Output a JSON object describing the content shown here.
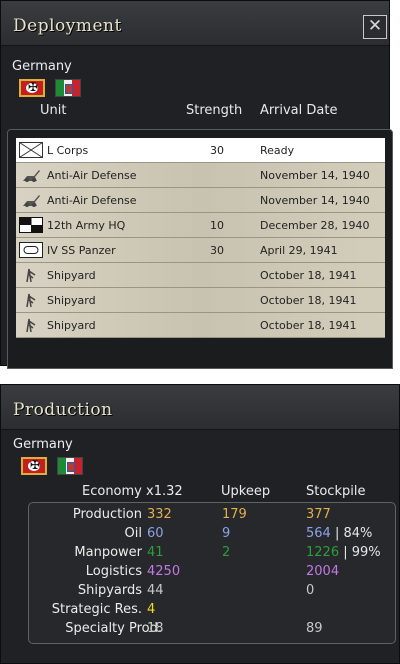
{
  "deployment": {
    "title": "Deployment",
    "close_glyph": "✕",
    "nation": "Germany",
    "columns": {
      "unit": "Unit",
      "strength": "Strength",
      "arrival": "Arrival Date"
    },
    "units": [
      {
        "icon": "infantry-corps-icon",
        "name": "L Corps",
        "strength": "30",
        "arrival": "Ready",
        "selected": true
      },
      {
        "icon": "anti-air-icon",
        "name": "Anti-Air Defense",
        "strength": "",
        "arrival": "November 14, 1940"
      },
      {
        "icon": "anti-air-icon",
        "name": "Anti-Air Defense",
        "strength": "",
        "arrival": "November 14, 1940"
      },
      {
        "icon": "hq-icon",
        "name": "12th Army HQ",
        "strength": "10",
        "arrival": "December 28, 1940"
      },
      {
        "icon": "armor-icon",
        "name": "IV SS Panzer",
        "strength": "30",
        "arrival": "April 29, 1941"
      },
      {
        "icon": "shipyard-icon",
        "name": "Shipyard",
        "strength": "",
        "arrival": "October 18, 1941"
      },
      {
        "icon": "shipyard-icon",
        "name": "Shipyard",
        "strength": "",
        "arrival": "October 18, 1941"
      },
      {
        "icon": "shipyard-icon",
        "name": "Shipyard",
        "strength": "",
        "arrival": "October 18, 1941"
      }
    ]
  },
  "production": {
    "title": "Production",
    "nation": "Germany",
    "columns": {
      "economy": "Economy x1.32",
      "upkeep": "Upkeep",
      "stockpile": "Stockpile"
    },
    "rows": {
      "production": {
        "label": "Production",
        "value": "332",
        "upkeep": "179",
        "stockpile": "377"
      },
      "oil": {
        "label": "Oil",
        "value": "60",
        "upkeep": "9",
        "stockpile": "564",
        "stockpile_pct": "84%"
      },
      "manpower": {
        "label": "Manpower",
        "value": "41",
        "upkeep": "2",
        "stockpile": "1226",
        "stockpile_pct": "99%"
      },
      "logistics": {
        "label": "Logistics",
        "value": "4250",
        "stockpile": "2004"
      },
      "shipyards": {
        "label": "Shipyards",
        "value": "44",
        "stockpile": "0"
      },
      "strategic": {
        "label": "Strategic Res.",
        "value": "4"
      },
      "specialty": {
        "label": "Specialty Prod.",
        "value": "18",
        "stockpile": "89"
      }
    },
    "separator": "|"
  },
  "colors": {
    "production": "#e2b04d",
    "oil": "#8fa2e8",
    "manpower": "#2f9e3a",
    "logistics": "#c279e6",
    "strategic": "#f1da2b"
  }
}
